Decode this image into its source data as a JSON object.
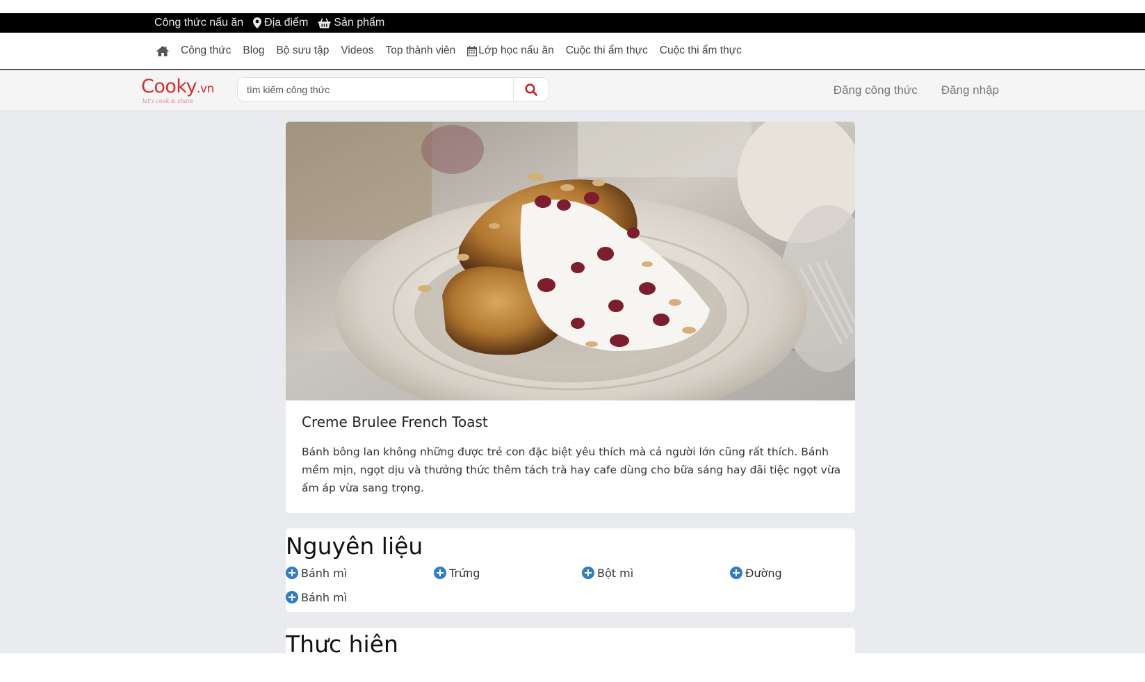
{
  "topbar": {
    "items": [
      {
        "label": "Công thức nấu ăn"
      },
      {
        "label": "Địa điểm"
      },
      {
        "label": "Sản phẩm"
      }
    ]
  },
  "nav": {
    "links": [
      "Công thức",
      "Blog",
      "Bộ sưu tập",
      "Videos",
      "Top thành viên",
      "Lớp học nấu ăn",
      "Cuộc thi ẩm thực",
      "Cuộc thi ẩm thực"
    ]
  },
  "header": {
    "logo_text": "Cooky",
    "logo_suffix": ".vn",
    "logo_tagline": "let's cook & share",
    "search_placeholder": "tìm kiếm công thức",
    "post_recipe": "Đăng công thức",
    "login": "Đăng nhập"
  },
  "recipe": {
    "title": "Creme Brulee French Toast",
    "description": "Bánh bông lan không những được trẻ con đặc biệt yêu thích mà cả người lớn cũng rất thích. Bánh mềm mịn, ngọt dịu và thưởng thức thêm tách trà hay cafe dùng cho bữa sáng hay đãi tiệc ngọt vừa ấm áp vừa sang trọng."
  },
  "ingredients": {
    "title": "Nguyên liệu",
    "items": [
      "Bánh mì",
      "Trứng",
      "Bột mì",
      "Đường",
      "Bánh mì"
    ]
  },
  "steps": {
    "title": "Thực hiện"
  },
  "colors": {
    "brand": "#d32f2f",
    "topbar": "#000000",
    "content_bg": "#e9ebee",
    "plus_icon": "#2f7dc8"
  }
}
